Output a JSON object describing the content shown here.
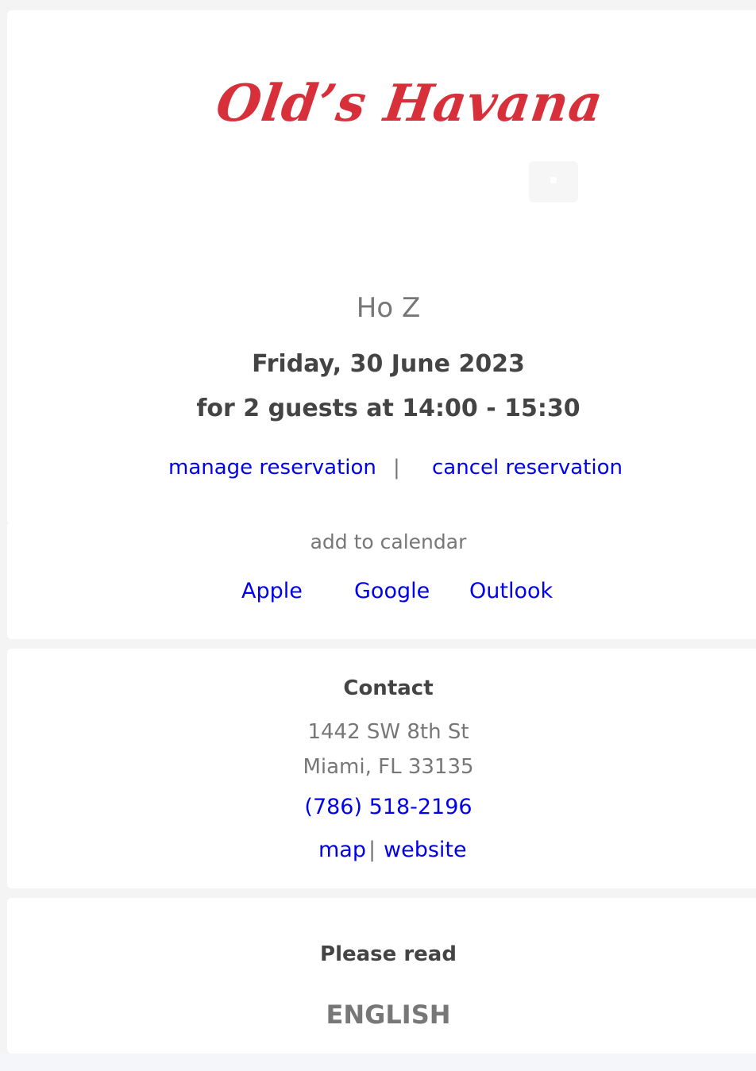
{
  "brand": {
    "logo_text": "Old’s Havana",
    "logo_color": "#d8303a"
  },
  "reservation": {
    "guest_name": "Ho Z",
    "date": "Friday, 30 June 2023",
    "details": "for 2 guests at 14:00 - 15:30",
    "manage_label": "manage reservation",
    "separator": "|",
    "cancel_label": "cancel reservation"
  },
  "calendar": {
    "label": "add to calendar",
    "options": [
      "Apple",
      "Google",
      "Outlook"
    ]
  },
  "contact": {
    "title": "Contact",
    "address_line1": "1442 SW 8th St",
    "address_line2": "Miami, FL 33135",
    "phone": "(786) 518-2196",
    "map_label": "map",
    "separator": "|",
    "website_label": "website"
  },
  "notice": {
    "title": "Please read",
    "language": "ENGLISH"
  },
  "colors": {
    "link": "#0000ee",
    "text_dark": "#444444",
    "text_muted": "#777777"
  }
}
